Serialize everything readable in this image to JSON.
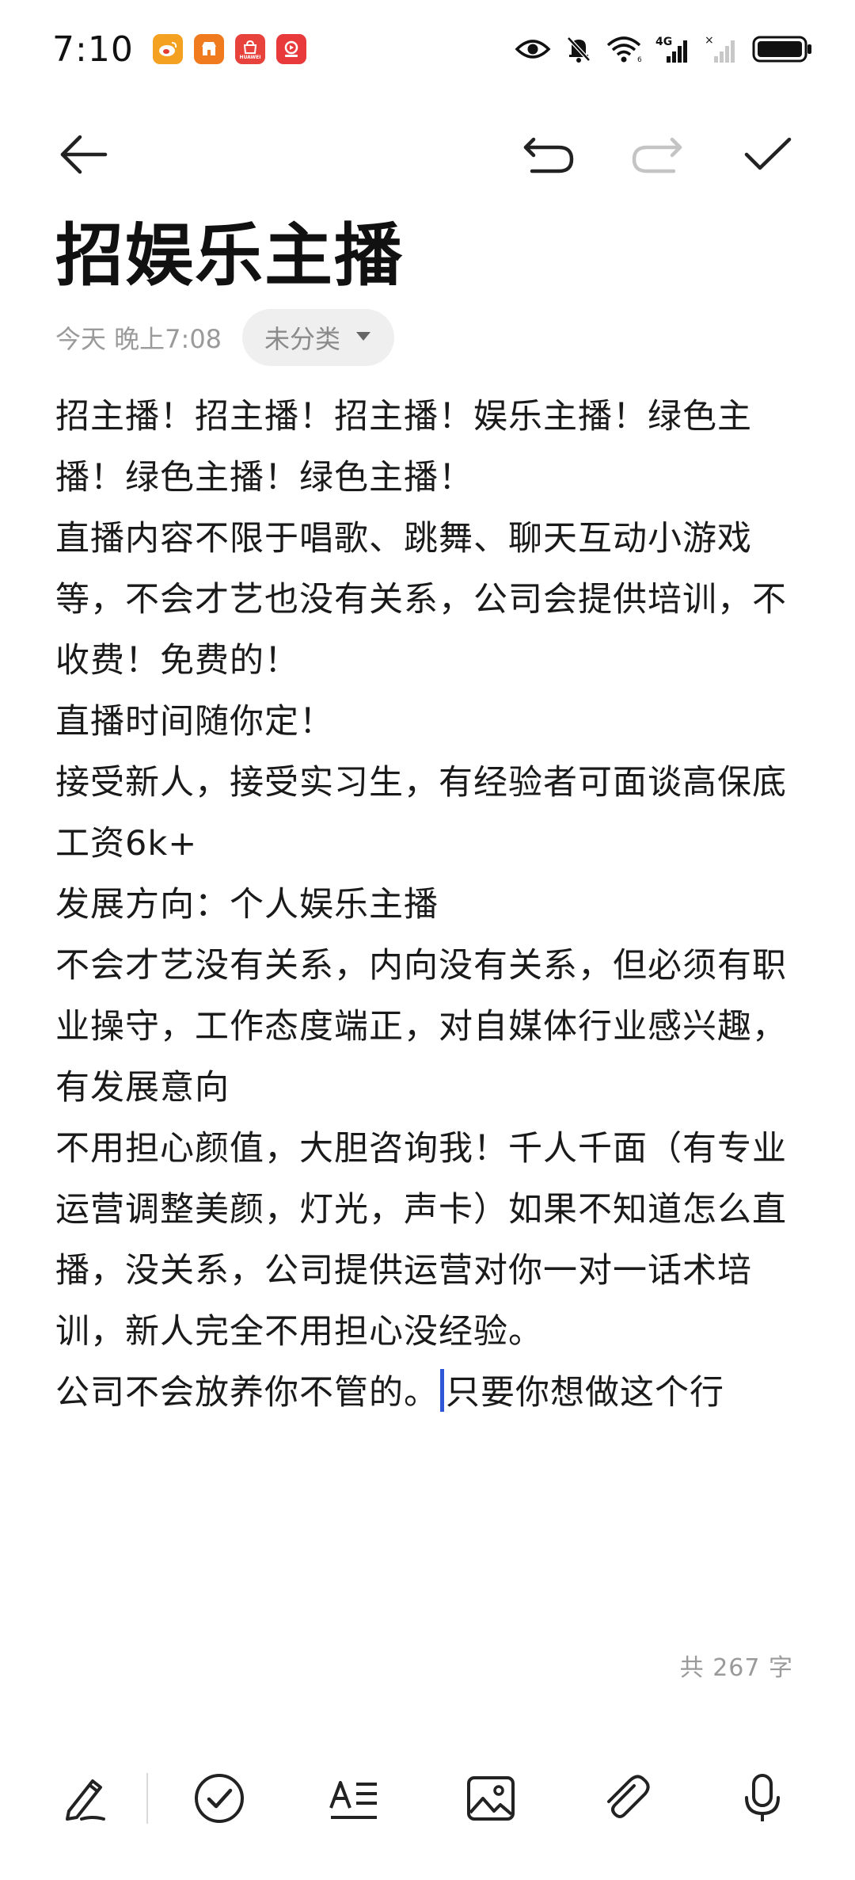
{
  "status_bar": {
    "time": "7:10",
    "apps": [
      {
        "icon": "weibo-icon",
        "color": "#f4a020",
        "glyph": "微"
      },
      {
        "icon": "shop-icon",
        "color": "#f07a1e",
        "glyph": "店"
      },
      {
        "icon": "huawei-store-icon",
        "color": "#e8423c",
        "glyph": "HW"
      },
      {
        "icon": "taobao-live-icon",
        "color": "#e83a3a",
        "glyph": "淘"
      }
    ],
    "network": "4G"
  },
  "toolbar": {
    "back": "back-arrow-icon",
    "undo": "undo-icon",
    "redo": "redo-icon",
    "done": "check-icon"
  },
  "note": {
    "title": "招娱乐主播",
    "time": "今天 晚上7:08",
    "category": "未分类",
    "paragraphs": [
      "招主播！招主播！招主播！娱乐主播！绿色主播！绿色主播！绿色主播！",
      "直播内容不限于唱歌、跳舞、聊天互动小游戏等，不会才艺也没有关系，公司会提供培训，不收费！免费的！",
      "直播时间随你定！",
      "接受新人，接受实习生，有经验者可面谈高保底工资6k+",
      "发展方向：个人娱乐主播",
      "不会才艺没有关系，内向没有关系，但必须有职业操守，工作态度端正，对自媒体行业感兴趣，有发展意向",
      "不用担心颜值，大胆咨询我！千人千面（有专业运营调整美颜，灯光，声卡）如果不知道怎么直播，没关系，公司提供运营对你一对一话术培训，新人完全不用担心没经验。"
    ],
    "last_line_before_cursor": "公司不会放养你不管的。",
    "last_line_after_cursor": "只要你想做这个行",
    "word_count": "共 267 字"
  },
  "bottom_toolbar": {
    "items": [
      "handwriting-icon",
      "checklist-icon",
      "text-style-icon",
      "image-icon",
      "attachment-icon",
      "microphone-icon"
    ]
  },
  "colors": {
    "cursor": "#2f56d6",
    "muted_text": "#9a9a9a",
    "chip_bg": "#efefef"
  }
}
